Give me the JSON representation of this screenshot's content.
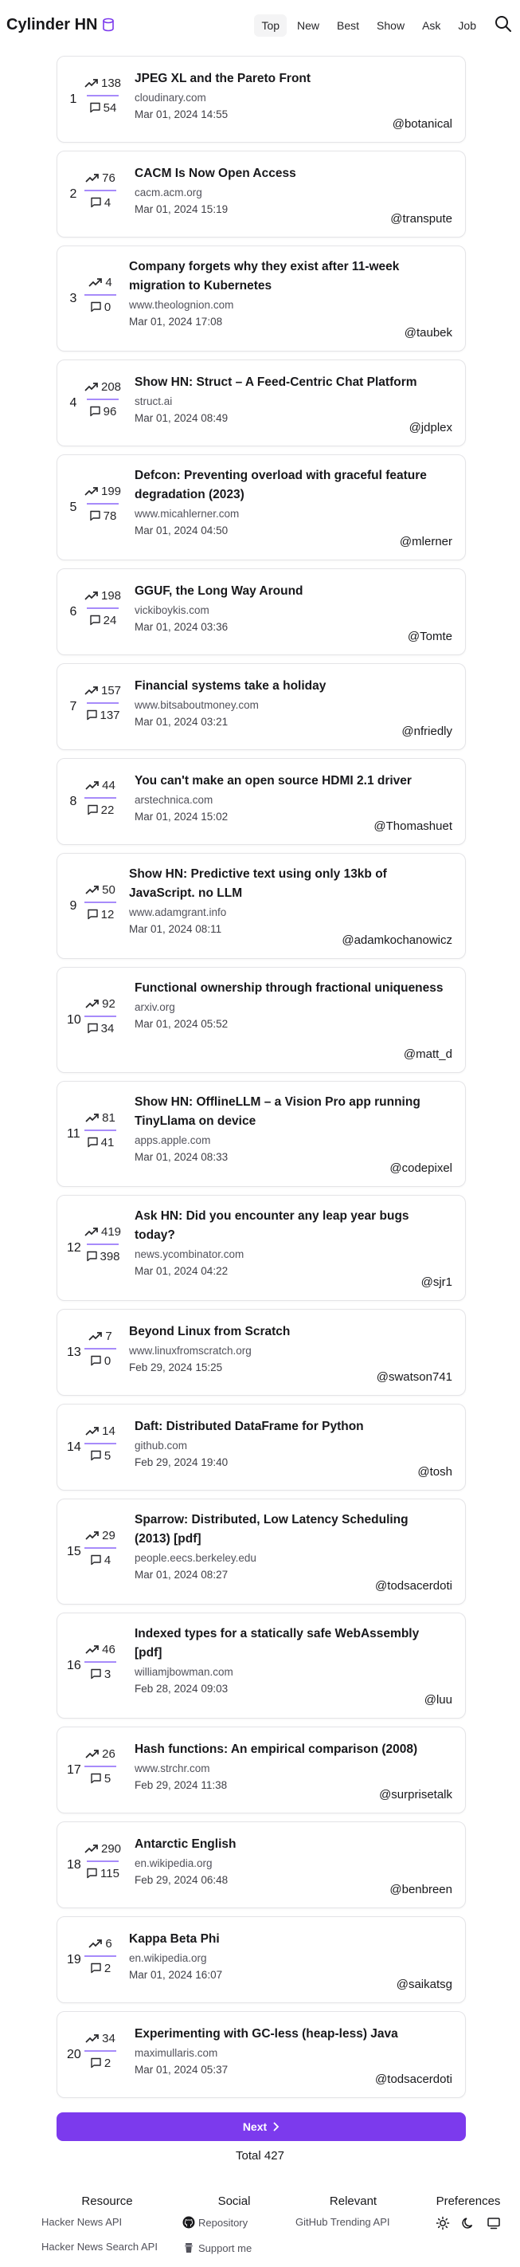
{
  "app": {
    "title": "Cylinder HN"
  },
  "nav": {
    "tabs": [
      {
        "label": "Top"
      },
      {
        "label": "New"
      },
      {
        "label": "Best"
      },
      {
        "label": "Show"
      },
      {
        "label": "Ask"
      },
      {
        "label": "Job"
      }
    ]
  },
  "accent_color": "#7c3aed",
  "stories": [
    {
      "rank": "1",
      "points": "138",
      "comments": "54",
      "title": "JPEG XL and the Pareto Front",
      "domain": "cloudinary.com",
      "date": "Mar 01, 2024 14:55",
      "author": "@botanical"
    },
    {
      "rank": "2",
      "points": "76",
      "comments": "4",
      "title": "CACM Is Now Open Access",
      "domain": "cacm.acm.org",
      "date": "Mar 01, 2024 15:19",
      "author": "@transpute"
    },
    {
      "rank": "3",
      "points": "4",
      "comments": "0",
      "title": "Company forgets why they exist after 11-week migration to Kubernetes",
      "domain": "www.theolognion.com",
      "date": "Mar 01, 2024 17:08",
      "author": "@taubek"
    },
    {
      "rank": "4",
      "points": "208",
      "comments": "96",
      "title": "Show HN: Struct – A Feed-Centric Chat Platform",
      "domain": "struct.ai",
      "date": "Mar 01, 2024 08:49",
      "author": "@jdplex"
    },
    {
      "rank": "5",
      "points": "199",
      "comments": "78",
      "title": "Defcon: Preventing overload with graceful feature degradation (2023)",
      "domain": "www.micahlerner.com",
      "date": "Mar 01, 2024 04:50",
      "author": "@mlerner"
    },
    {
      "rank": "6",
      "points": "198",
      "comments": "24",
      "title": "GGUF, the Long Way Around",
      "domain": "vickiboykis.com",
      "date": "Mar 01, 2024 03:36",
      "author": "@Tomte"
    },
    {
      "rank": "7",
      "points": "157",
      "comments": "137",
      "title": "Financial systems take a holiday",
      "domain": "www.bitsaboutmoney.com",
      "date": "Mar 01, 2024 03:21",
      "author": "@nfriedly"
    },
    {
      "rank": "8",
      "points": "44",
      "comments": "22",
      "title": "You can't make an open source HDMI 2.1 driver",
      "domain": "arstechnica.com",
      "date": "Mar 01, 2024 15:02",
      "author": "@Thomashuet"
    },
    {
      "rank": "9",
      "points": "50",
      "comments": "12",
      "title": "Show HN: Predictive text using only 13kb of JavaScript. no LLM",
      "domain": "www.adamgrant.info",
      "date": "Mar 01, 2024 08:11",
      "author": "@adamkochanowicz"
    },
    {
      "rank": "10",
      "points": "92",
      "comments": "34",
      "title": "Functional ownership through fractional uniqueness",
      "domain": "arxiv.org",
      "date": "Mar 01, 2024 05:52",
      "author": "@matt_d"
    },
    {
      "rank": "11",
      "points": "81",
      "comments": "41",
      "title": "Show HN: OfflineLLM – a Vision Pro app running TinyLlama on device",
      "domain": "apps.apple.com",
      "date": "Mar 01, 2024 08:33",
      "author": "@codepixel"
    },
    {
      "rank": "12",
      "points": "419",
      "comments": "398",
      "title": "Ask HN: Did you encounter any leap year bugs today?",
      "domain": "news.ycombinator.com",
      "date": "Mar 01, 2024 04:22",
      "author": "@sjr1"
    },
    {
      "rank": "13",
      "points": "7",
      "comments": "0",
      "title": "Beyond Linux from Scratch",
      "domain": "www.linuxfromscratch.org",
      "date": "Feb 29, 2024 15:25",
      "author": "@swatson741"
    },
    {
      "rank": "14",
      "points": "14",
      "comments": "5",
      "title": "Daft: Distributed DataFrame for Python",
      "domain": "github.com",
      "date": "Feb 29, 2024 19:40",
      "author": "@tosh"
    },
    {
      "rank": "15",
      "points": "29",
      "comments": "4",
      "title": "Sparrow: Distributed, Low Latency Scheduling (2013) [pdf]",
      "domain": "people.eecs.berkeley.edu",
      "date": "Mar 01, 2024 08:27",
      "author": "@todsacerdoti"
    },
    {
      "rank": "16",
      "points": "46",
      "comments": "3",
      "title": "Indexed types for a statically safe WebAssembly [pdf]",
      "domain": "williamjbowman.com",
      "date": "Feb 28, 2024 09:03",
      "author": "@luu"
    },
    {
      "rank": "17",
      "points": "26",
      "comments": "5",
      "title": "Hash functions: An empirical comparison (2008)",
      "domain": "www.strchr.com",
      "date": "Feb 29, 2024 11:38",
      "author": "@surprisetalk"
    },
    {
      "rank": "18",
      "points": "290",
      "comments": "115",
      "title": "Antarctic English",
      "domain": "en.wikipedia.org",
      "date": "Feb 29, 2024 06:48",
      "author": "@benbreen"
    },
    {
      "rank": "19",
      "points": "6",
      "comments": "2",
      "title": "Kappa Beta Phi",
      "domain": "en.wikipedia.org",
      "date": "Mar 01, 2024 16:07",
      "author": "@saikatsg"
    },
    {
      "rank": "20",
      "points": "34",
      "comments": "2",
      "title": "Experimenting with GC-less (heap-less) Java",
      "domain": "maximullaris.com",
      "date": "Mar 01, 2024 05:37",
      "author": "@todsacerdoti"
    }
  ],
  "pagination": {
    "next_label": "Next",
    "total_label": "Total",
    "total_value": "427"
  },
  "footer": {
    "resource": {
      "title": "Resource",
      "links": [
        "Hacker News API",
        "Hacker News Search API"
      ]
    },
    "social": {
      "title": "Social",
      "links": [
        "Repository",
        "Support me"
      ]
    },
    "relevant": {
      "title": "Relevant",
      "links": [
        "GitHub Trending API"
      ]
    },
    "preferences": {
      "title": "Preferences"
    }
  }
}
